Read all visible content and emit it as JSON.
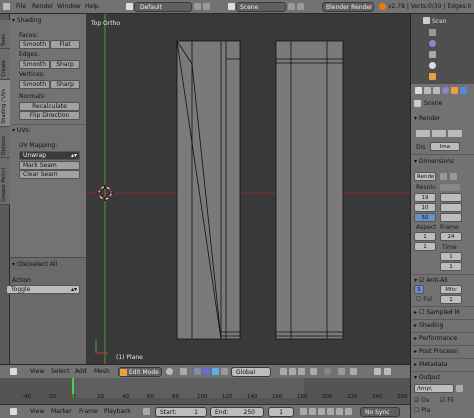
{
  "topbar": {
    "menus": [
      "File",
      "Render",
      "Window",
      "Help"
    ],
    "layout": "Default",
    "scene": "Scene",
    "engine": "Blender Render",
    "stats": "v2.78 | Verts:0/30 | Edges:0"
  },
  "tool_tabs": [
    "Tools",
    "Create",
    "Shading / UVs",
    "Options",
    "Grease Pencil"
  ],
  "shelf": {
    "shading_header": "Shading",
    "faces_label": "Faces:",
    "smooth": "Smooth",
    "flat": "Flat",
    "edges_label": "Edges:",
    "sharp": "Sharp",
    "vertices_label": "Vertices:",
    "normals_label": "Normals:",
    "recalculate": "Recalculate",
    "flip_direction": "Flip Direction",
    "uvs_header": "UVs:",
    "uv_mapping_label": "UV Mapping:",
    "unwrap": "Unwrap",
    "mark_seam": "Mark Seam",
    "clear_seam": "Clear Seam",
    "operator_title": "(De)select All",
    "action_label": "Action",
    "action_value": "Toggle"
  },
  "viewport": {
    "view_name": "Top Ortho",
    "object_name": "(1) Plane",
    "colors": {
      "bg": "#393939",
      "mesh_fill": "#7a7a7a",
      "x_axis": "#8a2a2a",
      "y_axis": "#4a9a3a"
    }
  },
  "viewport_header": {
    "menus": [
      "View",
      "Select",
      "Add",
      "Mesh"
    ],
    "mode": "Edit Mode",
    "pivot": "Global"
  },
  "timeline": {
    "ruler": [
      "-40",
      "-20",
      "0",
      "20",
      "40",
      "60",
      "80",
      "100",
      "120",
      "140",
      "160",
      "180",
      "200",
      "220",
      "240",
      "260"
    ],
    "current_frame_color": "#4ad04a"
  },
  "timeline_footer": {
    "menus": [
      "View",
      "Marker",
      "Frame",
      "Playback"
    ],
    "start_label": "Start:",
    "start_value": "1",
    "end_label": "End:",
    "end_value": "250",
    "current": "1"
  },
  "outliner": {
    "root": "Scen"
  },
  "properties": {
    "breadcrumb": "Scene",
    "render_header": "Render",
    "display_label": "Dis",
    "display_value": "Ima",
    "dimensions_header": "Dimensions",
    "preset": "Rende",
    "resolution_label": "Resolu",
    "res_x": "19",
    "res_y": "10",
    "res_pct": "50",
    "aspect_label": "Aspect",
    "aspect_x": "1",
    "aspect_y": "1",
    "frame_label": "Frame",
    "frame_rate": "24",
    "time_label": "Time",
    "time_value": "1",
    "anti_alias": "Anti-Ali",
    "aa_samples": "5",
    "aa_filter": "Mitc",
    "full_sample": "Ful",
    "full_value": "1",
    "sampled_motion": "Sampled M",
    "shading": "Shading",
    "performance": "Performance",
    "post_processing": "Post Processi",
    "metadata": "Metadata",
    "output": "Output",
    "output_path": "/tmp\\",
    "overwrite": "Ov",
    "file_ext": "Fil",
    "placeholders": "Pla",
    "no_sync": "No Sync"
  }
}
